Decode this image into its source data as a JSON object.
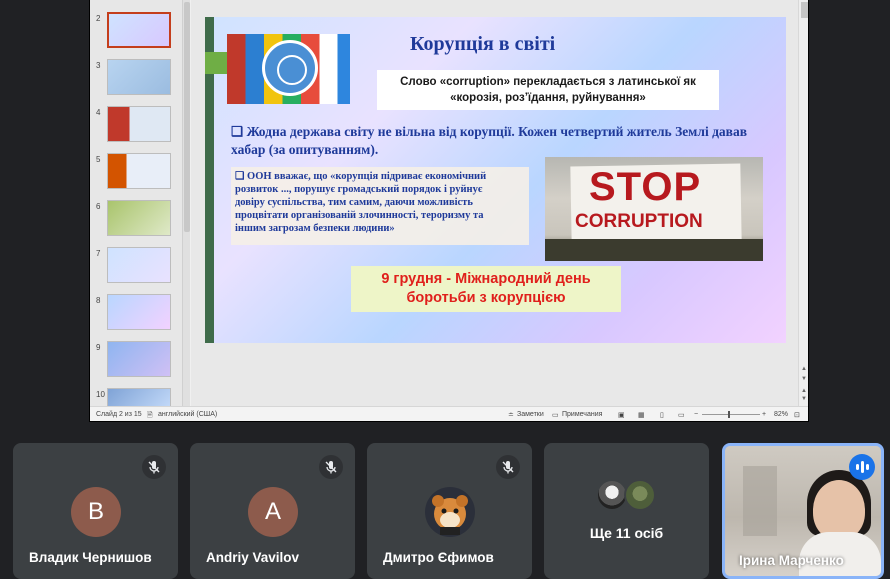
{
  "thumbnails": {
    "numbers": [
      "2",
      "3",
      "4",
      "5",
      "6",
      "7",
      "8",
      "9",
      "10"
    ],
    "selected": "2"
  },
  "slide": {
    "title": "Корупція  в світі",
    "definition_line1": "Слово «corruption» перекладається з латинської як",
    "definition_line2": "«корозія, розʼїдання, руйнування»",
    "paragraph1": "❑ Жодна держава світу не вільна від корупції. Кожен четвертий житель Землі давав хабар (за опитуванням).",
    "paragraph2_lines": [
      "❑ ООН вважає, що «корупція підриває економічний",
      "розвиток ..., порушує громадський порядок і руйнує",
      "довіру суспільства, тим самим, даючи можливість",
      "процвітати організованій злочинності, тероризму та",
      "іншим загрозам безпеки людини»"
    ],
    "stop_sign_line1": "STOP",
    "stop_sign_line2": "CORRUPTION",
    "date_line1": "9 грудня - Міжнародний день",
    "date_line2": "боротьби з корупцією"
  },
  "statusbar": {
    "slide_counter": "Слайд 2 из 15",
    "language": "английский (США)",
    "notes": "Заметки",
    "comments": "Примечания",
    "zoom": "82%"
  },
  "participants": [
    {
      "initial": "В",
      "name": "Владик Чернишов",
      "avatar_color": "#8d5b4c",
      "muted": true
    },
    {
      "initial": "A",
      "name": "Andriy Vavilov",
      "avatar_color": "#8d5b4c",
      "muted": true
    },
    {
      "initial": "",
      "name": "Дмитро Єфимов",
      "avatar_color": "#2b2f3a",
      "muted": true
    }
  ],
  "more": {
    "label": "Ще 11 осіб"
  },
  "speaker": {
    "name": "Ірина Марченко",
    "active_color": "#8ab4f8"
  },
  "icons": {
    "mic": "mic-off-icon",
    "speaking": "speaking-indicator-icon"
  }
}
